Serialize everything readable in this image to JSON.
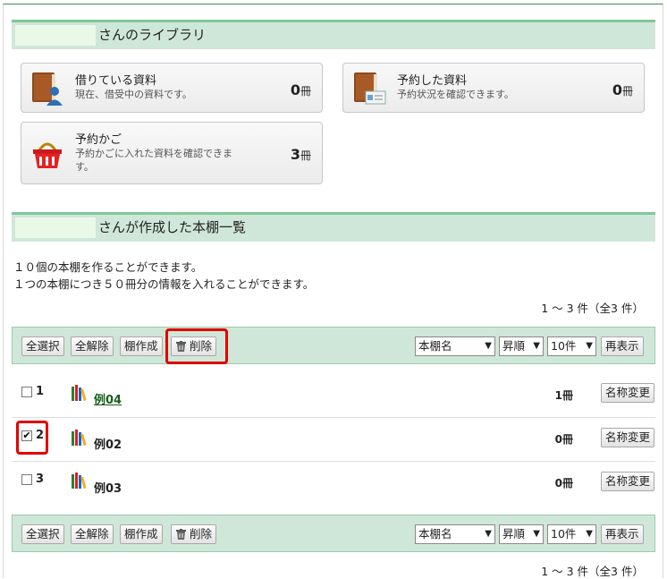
{
  "library": {
    "header_suffix": "さんのライブラリ",
    "cards": [
      {
        "title": "借りている資料",
        "desc": "現在、借受中の資料です。",
        "count": "0",
        "unit": "冊",
        "icon": "borrowed-book-icon"
      },
      {
        "title": "予約した資料",
        "desc": "予約状況を確認できます。",
        "count": "0",
        "unit": "冊",
        "icon": "reserved-book-icon"
      },
      {
        "title": "予約かご",
        "desc": "予約かごに入れた資料を確認できます。",
        "count": "3",
        "unit": "冊",
        "icon": "basket-icon"
      }
    ]
  },
  "shelves": {
    "header_suffix": "さんが作成した本棚一覧",
    "info_line1": "１０個の本棚を作ることができます。",
    "info_line2": "１つの本棚につき５０冊分の情報を入れることができます。",
    "pager_text": "1 ～ 3 件（全3 件）",
    "toolbar": {
      "select_all": "全選択",
      "deselect_all": "全解除",
      "create": "棚作成",
      "delete": "削除",
      "sort_field": "本棚名",
      "sort_order": "昇順",
      "per_page": "10件",
      "redisplay": "再表示"
    },
    "rename_label": "名称変更",
    "rows": [
      {
        "no": "1",
        "name": "例04",
        "count": "1冊",
        "checked": false,
        "link": true
      },
      {
        "no": "2",
        "name": "例02",
        "count": "0冊",
        "checked": true,
        "link": false
      },
      {
        "no": "3",
        "name": "例03",
        "count": "0冊",
        "checked": false,
        "link": false
      }
    ]
  },
  "colors": {
    "accent_green": "#7fc79a",
    "panel_green": "#cfe7d8",
    "highlight_red": "#e00000",
    "link_green": "#1b5e20"
  }
}
